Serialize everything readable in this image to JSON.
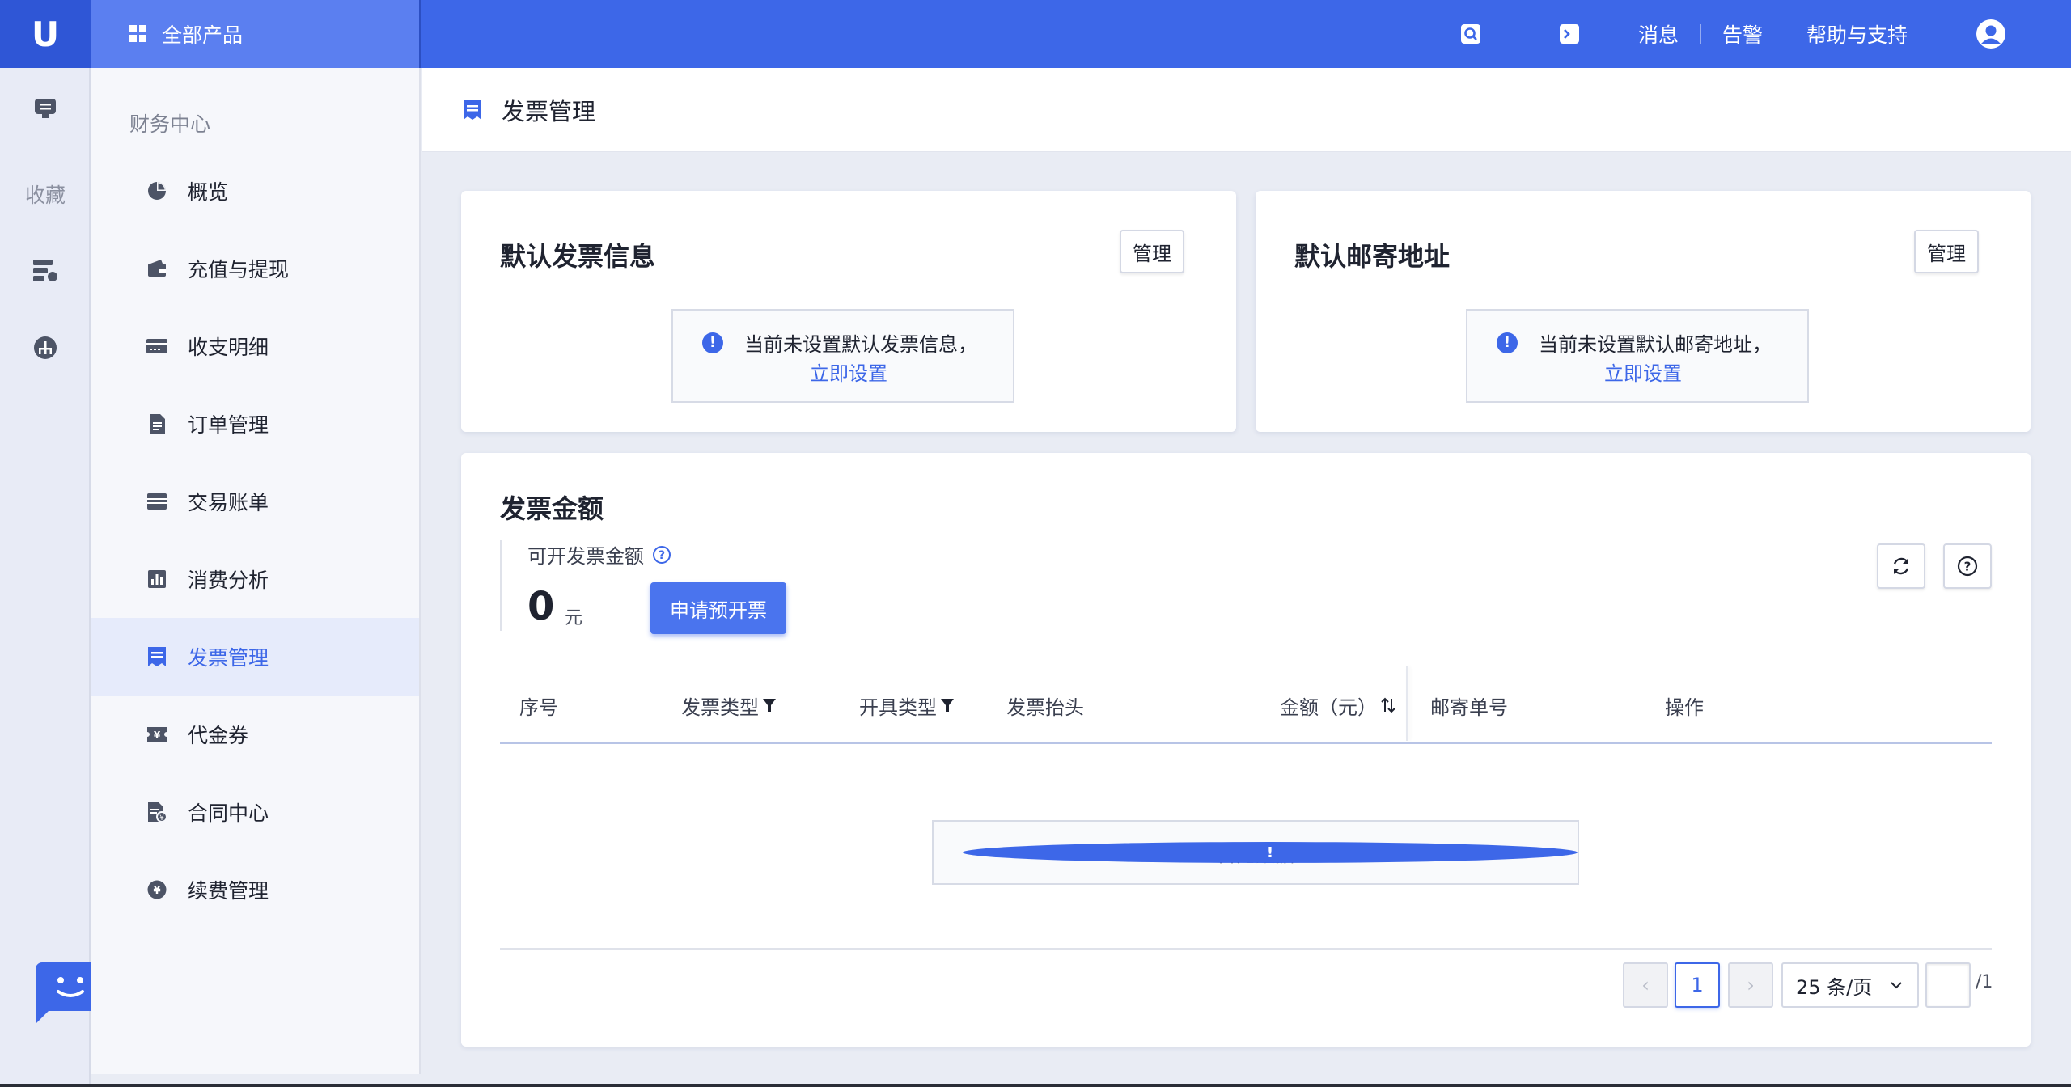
{
  "topbar": {
    "logo": "U",
    "all_products": "全部产品",
    "messages": "消息",
    "alerts": "告警",
    "help": "帮助与支持"
  },
  "rail": {
    "favorites": "收藏"
  },
  "sidebar": {
    "section_title": "财务中心",
    "items": [
      {
        "label": "概览",
        "icon": "pie-chart-icon"
      },
      {
        "label": "充值与提现",
        "icon": "wallet-icon"
      },
      {
        "label": "收支明细",
        "icon": "card-icon"
      },
      {
        "label": "订单管理",
        "icon": "document-icon"
      },
      {
        "label": "交易账单",
        "icon": "bill-icon"
      },
      {
        "label": "消费分析",
        "icon": "bar-chart-icon"
      },
      {
        "label": "发票管理",
        "icon": "invoice-icon",
        "active": true
      },
      {
        "label": "代金券",
        "icon": "voucher-icon"
      },
      {
        "label": "合同中心",
        "icon": "contract-icon"
      },
      {
        "label": "续费管理",
        "icon": "yen-circle-icon"
      }
    ]
  },
  "page": {
    "title": "发票管理"
  },
  "invoice_info": {
    "title": "默认发票信息",
    "manage": "管理",
    "notice": "当前未设置默认发票信息，",
    "link": "立即设置"
  },
  "mail_address": {
    "title": "默认邮寄地址",
    "manage": "管理",
    "notice": "当前未设置默认邮寄地址，",
    "link": "立即设置"
  },
  "amount": {
    "title": "发票金额",
    "label": "可开发票金额",
    "value": "0",
    "unit": "元",
    "apply_button": "申请预开票"
  },
  "table": {
    "columns": [
      "序号",
      "发票类型",
      "开具类型",
      "发票抬头",
      "金额（元）",
      "邮寄单号",
      "操作"
    ],
    "rows": [],
    "empty_text": "暂无数据"
  },
  "pagination": {
    "prev": "‹",
    "current_page": "1",
    "next": "›",
    "page_size": "25 条/页",
    "jump_value": "",
    "total_pages": "/1"
  },
  "colors": {
    "accent": "#3d67e8",
    "topbar": "#3d67e8"
  }
}
